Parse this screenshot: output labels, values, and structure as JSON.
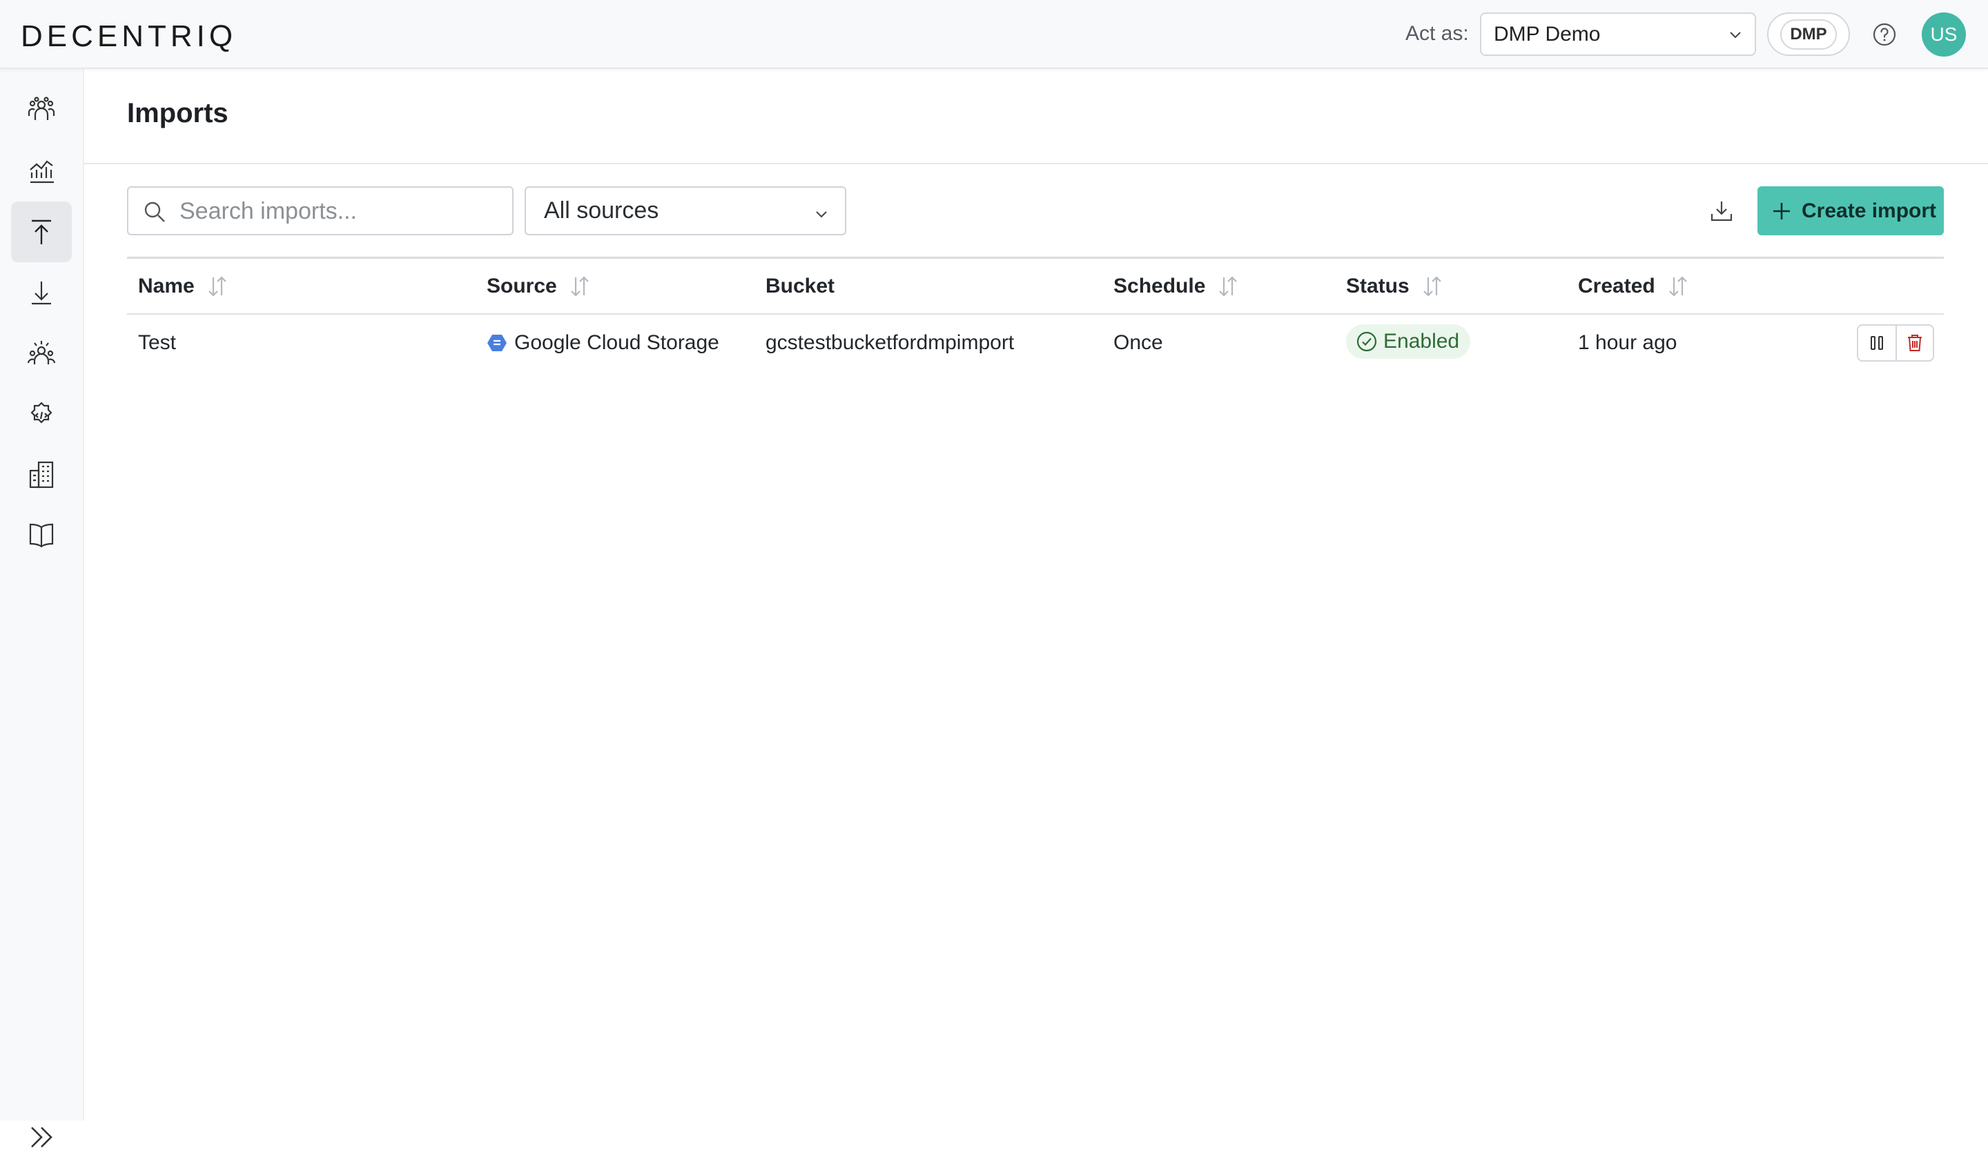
{
  "header": {
    "logo": "DECENTRIQ",
    "act_as_label": "Act as:",
    "act_as_value": "DMP Demo",
    "org_badge": "DMP",
    "avatar_initials": "US"
  },
  "sidebar": {
    "items": [
      {
        "icon": "people-icon",
        "active": false
      },
      {
        "icon": "chart-icon",
        "active": false
      },
      {
        "icon": "upload-icon",
        "active": true
      },
      {
        "icon": "download-icon",
        "active": false
      },
      {
        "icon": "audience-icon",
        "active": false
      },
      {
        "icon": "code-gear-icon",
        "active": false
      },
      {
        "icon": "building-icon",
        "active": false
      },
      {
        "icon": "book-icon",
        "active": false
      }
    ],
    "collapse_icon": "double-chevron-right-icon"
  },
  "page": {
    "title": "Imports",
    "search_placeholder": "Search imports...",
    "source_filter": "All sources",
    "create_button": "Create import"
  },
  "table": {
    "columns": [
      "Name",
      "Source",
      "Bucket",
      "Schedule",
      "Status",
      "Created"
    ],
    "rows": [
      {
        "name": "Test",
        "source": "Google Cloud Storage",
        "bucket": "gcstestbucketfordmpimport",
        "schedule": "Once",
        "status": "Enabled",
        "created": "1 hour ago"
      }
    ]
  },
  "colors": {
    "accent": "#4fc3b2",
    "avatar": "#43b8a6",
    "status_enabled_bg": "#eaf6ec",
    "status_enabled_fg": "#2f6b36",
    "delete": "#c62828"
  }
}
